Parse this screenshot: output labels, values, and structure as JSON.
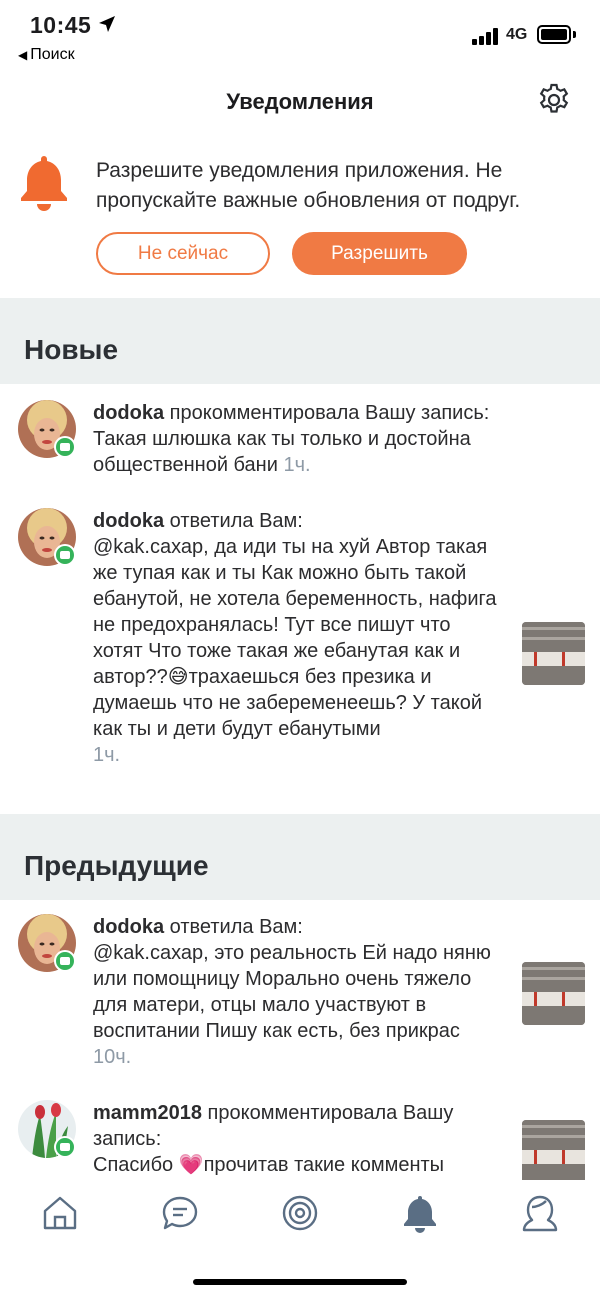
{
  "status_bar": {
    "time": "10:45",
    "back_app": "Поиск",
    "network": "4G",
    "icons": [
      "location-arrow-icon",
      "signal-icon",
      "battery-icon"
    ]
  },
  "header": {
    "title": "Уведомления",
    "settings_icon": "gear-icon"
  },
  "permission_banner": {
    "text": "Разрешите уведомления приложения. Не пропускайте важные обновления от подруг.",
    "later_label": "Не сейчас",
    "allow_label": "Разрешить",
    "icon": "bell-icon",
    "accent_color": "#f07a44"
  },
  "sections": {
    "new_title": "Новые",
    "previous_title": "Предыдущие"
  },
  "notifications": [
    {
      "user": "dodoka",
      "action": " прокомментировала Вашу запись:",
      "text": "Такая шлюшка как ты только и достойна общественной бани",
      "time": "1ч."
    },
    {
      "user": "dodoka",
      "action": " ответила Вам:",
      "text": "@kak.сахар, да иди ты на хуй Автор такая же тупая как и ты  Как можно быть такой ебанутой, не хотела беременность, нафига не предохранялась! Тут все пишут что хотят  Что тоже такая же ебанутая как и автор??😅трахаешься без презика и думаешь что не забеременеешь? У такой как ты и дети будут ебанутыми",
      "time": "1ч."
    },
    {
      "user": "dodoka",
      "action": " ответила Вам:",
      "text": "@kak.сахар, это реальность Ей надо няню или помощницу  Морально очень тяжело для матери, отцы мало участвуют в воспитании  Пишу как есть, без прикрас",
      "time": "10ч."
    },
    {
      "user": "mamm2018",
      "action": " прокомментировала Вашу запись:",
      "text": "Спасибо 💗прочитав такие комменты",
      "time": ""
    }
  ],
  "tabbar": {
    "tabs": [
      "home-icon",
      "chat-icon",
      "target-icon",
      "bell-icon",
      "profile-icon"
    ],
    "active_tab": "bell-icon"
  }
}
